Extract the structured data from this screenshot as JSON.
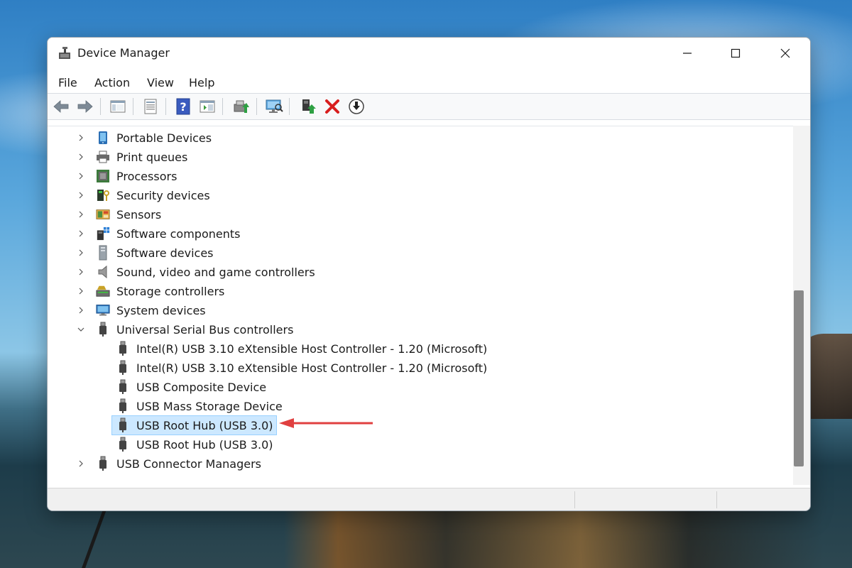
{
  "window": {
    "title": "Device Manager",
    "controls": {
      "minimize": "—",
      "maximize": "☐",
      "close": "✕"
    }
  },
  "menu": [
    "File",
    "Action",
    "View",
    "Help"
  ],
  "toolbar": [
    {
      "name": "back-button",
      "icon": "arrow-left-icon"
    },
    {
      "name": "forward-button",
      "icon": "arrow-right-icon"
    },
    {
      "name": "show-hide-console-tree-button",
      "icon": "console-tree-icon"
    },
    {
      "name": "properties-button",
      "icon": "properties-icon"
    },
    {
      "name": "help-button",
      "icon": "help-icon"
    },
    {
      "name": "show-hide-action-pane-button",
      "icon": "action-pane-icon"
    },
    {
      "name": "update-driver-button",
      "icon": "update-driver-icon"
    },
    {
      "name": "scan-hardware-button",
      "icon": "scan-hardware-icon"
    },
    {
      "name": "enable-device-button",
      "icon": "enable-device-icon"
    },
    {
      "name": "uninstall-device-button",
      "icon": "uninstall-x-icon"
    },
    {
      "name": "disable-device-button",
      "icon": "download-circle-icon"
    }
  ],
  "tree": {
    "rows": [
      {
        "label": "Portable Devices",
        "level": 0,
        "expanded": false,
        "icon": "portable-device-icon",
        "selected": false
      },
      {
        "label": "Print queues",
        "level": 0,
        "expanded": false,
        "icon": "printer-icon",
        "selected": false
      },
      {
        "label": "Processors",
        "level": 0,
        "expanded": false,
        "icon": "processor-icon",
        "selected": false
      },
      {
        "label": "Security devices",
        "level": 0,
        "expanded": false,
        "icon": "security-device-icon",
        "selected": false
      },
      {
        "label": "Sensors",
        "level": 0,
        "expanded": false,
        "icon": "sensor-icon",
        "selected": false
      },
      {
        "label": "Software components",
        "level": 0,
        "expanded": false,
        "icon": "software-component-icon",
        "selected": false
      },
      {
        "label": "Software devices",
        "level": 0,
        "expanded": false,
        "icon": "software-device-icon",
        "selected": false
      },
      {
        "label": "Sound, video and game controllers",
        "level": 0,
        "expanded": false,
        "icon": "speaker-icon",
        "selected": false
      },
      {
        "label": "Storage controllers",
        "level": 0,
        "expanded": false,
        "icon": "storage-controller-icon",
        "selected": false
      },
      {
        "label": "System devices",
        "level": 0,
        "expanded": false,
        "icon": "monitor-icon",
        "selected": false
      },
      {
        "label": "Universal Serial Bus controllers",
        "level": 0,
        "expanded": true,
        "icon": "usb-plug-icon",
        "selected": false
      },
      {
        "label": "Intel(R) USB 3.10 eXtensible Host Controller - 1.20 (Microsoft)",
        "level": 1,
        "icon": "usb-plug-icon",
        "selected": false
      },
      {
        "label": "Intel(R) USB 3.10 eXtensible Host Controller - 1.20 (Microsoft)",
        "level": 1,
        "icon": "usb-plug-icon",
        "selected": false
      },
      {
        "label": "USB Composite Device",
        "level": 1,
        "icon": "usb-plug-icon",
        "selected": false
      },
      {
        "label": "USB Mass Storage Device",
        "level": 1,
        "icon": "usb-plug-icon",
        "selected": false
      },
      {
        "label": "USB Root Hub (USB 3.0)",
        "level": 1,
        "icon": "usb-plug-icon",
        "selected": true
      },
      {
        "label": "USB Root Hub (USB 3.0)",
        "level": 1,
        "icon": "usb-plug-icon",
        "selected": false
      },
      {
        "label": "USB Connector Managers",
        "level": 0,
        "expanded": false,
        "icon": "usb-plug-icon",
        "selected": false
      }
    ]
  },
  "colors": {
    "selection_bg": "#cce8ff",
    "selection_border": "#99d1ff",
    "annotation_arrow": "#e04040",
    "uninstall_red": "#d81e1e"
  }
}
